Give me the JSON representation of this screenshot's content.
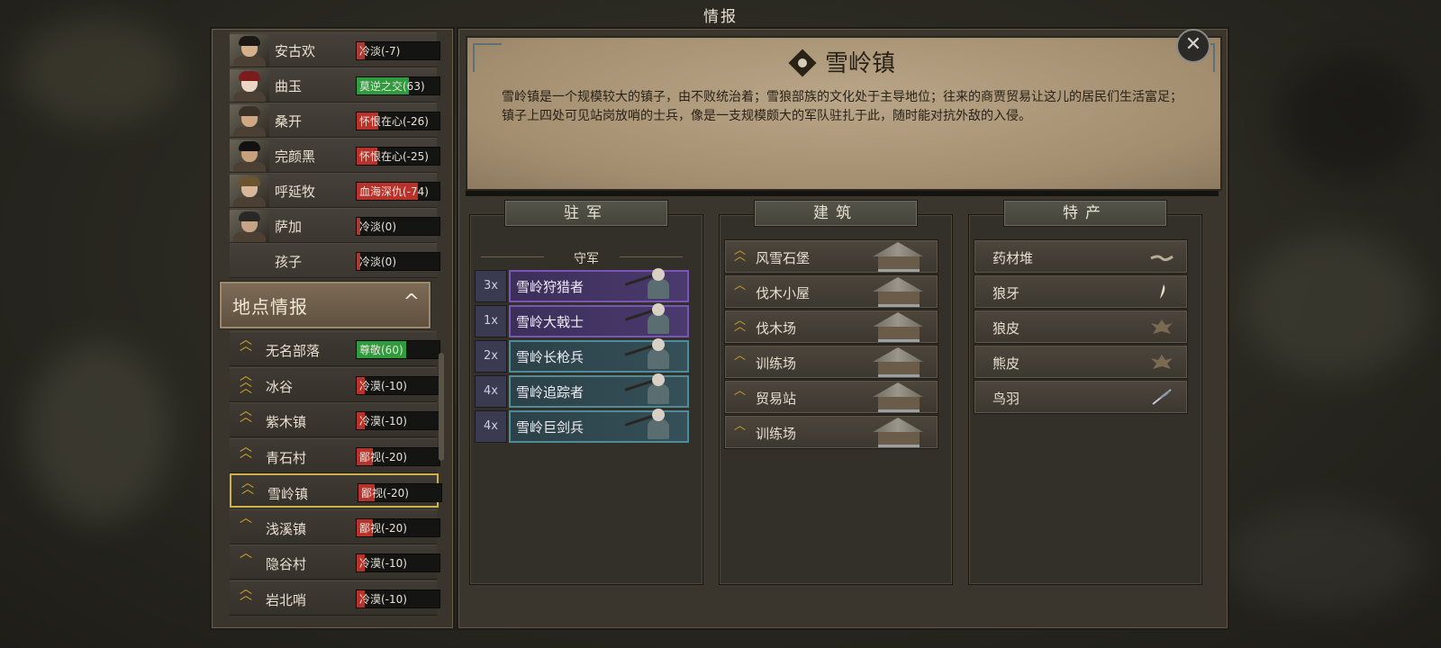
{
  "window_title": "情报",
  "characters": [
    {
      "name": "安古欢",
      "relation": "冷淡(-7)",
      "fill": 0.1,
      "color": "#a83a32",
      "skin": "#d4b08c",
      "hair": "#1b1815"
    },
    {
      "name": "曲玉",
      "relation": "莫逆之交(63)",
      "fill": 0.63,
      "color": "#2f9a3e",
      "skin": "#ecd6c6",
      "hair": "#7a1c1c"
    },
    {
      "name": "桑开",
      "relation": "怀恨在心(-26)",
      "fill": 0.26,
      "color": "#b8322c",
      "skin": "#d0a884",
      "hair": "#3a3128"
    },
    {
      "name": "完颜黑",
      "relation": "怀恨在心(-25)",
      "fill": 0.25,
      "color": "#b8322c",
      "skin": "#c9a07c",
      "hair": "#121110"
    },
    {
      "name": "呼延牧",
      "relation": "血海深仇(-74)",
      "fill": 0.74,
      "color": "#b8322c",
      "skin": "#d8b898",
      "hair": "#6b5430"
    },
    {
      "name": "萨加",
      "relation": "冷淡(0)",
      "fill": 0.0,
      "color": "#a83a32",
      "skin": "#c8a486",
      "hair": "#2a2826"
    },
    {
      "name": "孩子",
      "relation": "冷淡(0)",
      "fill": 0.0,
      "color": "#a83a32",
      "skin": "",
      "hair": ""
    }
  ],
  "locations_header": "地点情报",
  "locations_toggle": "^",
  "locations": [
    {
      "name": "无名部落",
      "rank": "^^",
      "relation": "尊敬(60)",
      "fill": 0.6,
      "color": "#2f9a3e",
      "selected": false
    },
    {
      "name": "冰谷",
      "rank": "^^^",
      "relation": "冷漠(-10)",
      "fill": 0.1,
      "color": "#b8322c",
      "selected": false
    },
    {
      "name": "紫木镇",
      "rank": "^^",
      "relation": "冷漠(-10)",
      "fill": 0.1,
      "color": "#b8322c",
      "selected": false
    },
    {
      "name": "青石村",
      "rank": "^^",
      "relation": "鄙视(-20)",
      "fill": 0.2,
      "color": "#b8322c",
      "selected": false
    },
    {
      "name": "雪岭镇",
      "rank": "^^",
      "relation": "鄙视(-20)",
      "fill": 0.2,
      "color": "#b8322c",
      "selected": true
    },
    {
      "name": "浅溪镇",
      "rank": "^",
      "relation": "鄙视(-20)",
      "fill": 0.2,
      "color": "#b8322c",
      "selected": false
    },
    {
      "name": "隐谷村",
      "rank": "^",
      "relation": "冷漠(-10)",
      "fill": 0.1,
      "color": "#b8322c",
      "selected": false
    },
    {
      "name": "岩北哨",
      "rank": "^^",
      "relation": "冷漠(-10)",
      "fill": 0.1,
      "color": "#b8322c",
      "selected": false
    }
  ],
  "town": {
    "name": "雪岭镇",
    "description": "雪岭镇是一个规模较大的镇子，由不败统治着；雪狼部族的文化处于主导地位；往来的商贾贸易让这儿的居民们生活富足；镇子上四处可见站岗放哨的士兵，像是一支规模颇大的军队驻扎于此，随时能对抗外敌的入侵。"
  },
  "garrison": {
    "tab": "驻军",
    "label": "守军",
    "troops": [
      {
        "count": "3x",
        "name": "雪岭狩猎者",
        "tier": "purple"
      },
      {
        "count": "1x",
        "name": "雪岭大戟士",
        "tier": "purple"
      },
      {
        "count": "2x",
        "name": "雪岭长枪兵",
        "tier": "blue"
      },
      {
        "count": "4x",
        "name": "雪岭追踪者",
        "tier": "blue"
      },
      {
        "count": "4x",
        "name": "雪岭巨剑兵",
        "tier": "blue"
      }
    ]
  },
  "buildings": {
    "tab": "建筑",
    "items": [
      {
        "name": "风雪石堡",
        "rank": "^^"
      },
      {
        "name": "伐木小屋",
        "rank": "^"
      },
      {
        "name": "伐木场",
        "rank": "^^"
      },
      {
        "name": "训练场",
        "rank": "^"
      },
      {
        "name": "贸易站",
        "rank": "^"
      },
      {
        "name": "训练场",
        "rank": "^"
      }
    ]
  },
  "products": {
    "tab": "特产",
    "items": [
      {
        "name": "药材堆",
        "icon": "herb-icon"
      },
      {
        "name": "狼牙",
        "icon": "fang-icon"
      },
      {
        "name": "狼皮",
        "icon": "pelt-icon"
      },
      {
        "name": "熊皮",
        "icon": "pelt-icon"
      },
      {
        "name": "鸟羽",
        "icon": "feather-icon"
      }
    ]
  },
  "close_label": "✕"
}
